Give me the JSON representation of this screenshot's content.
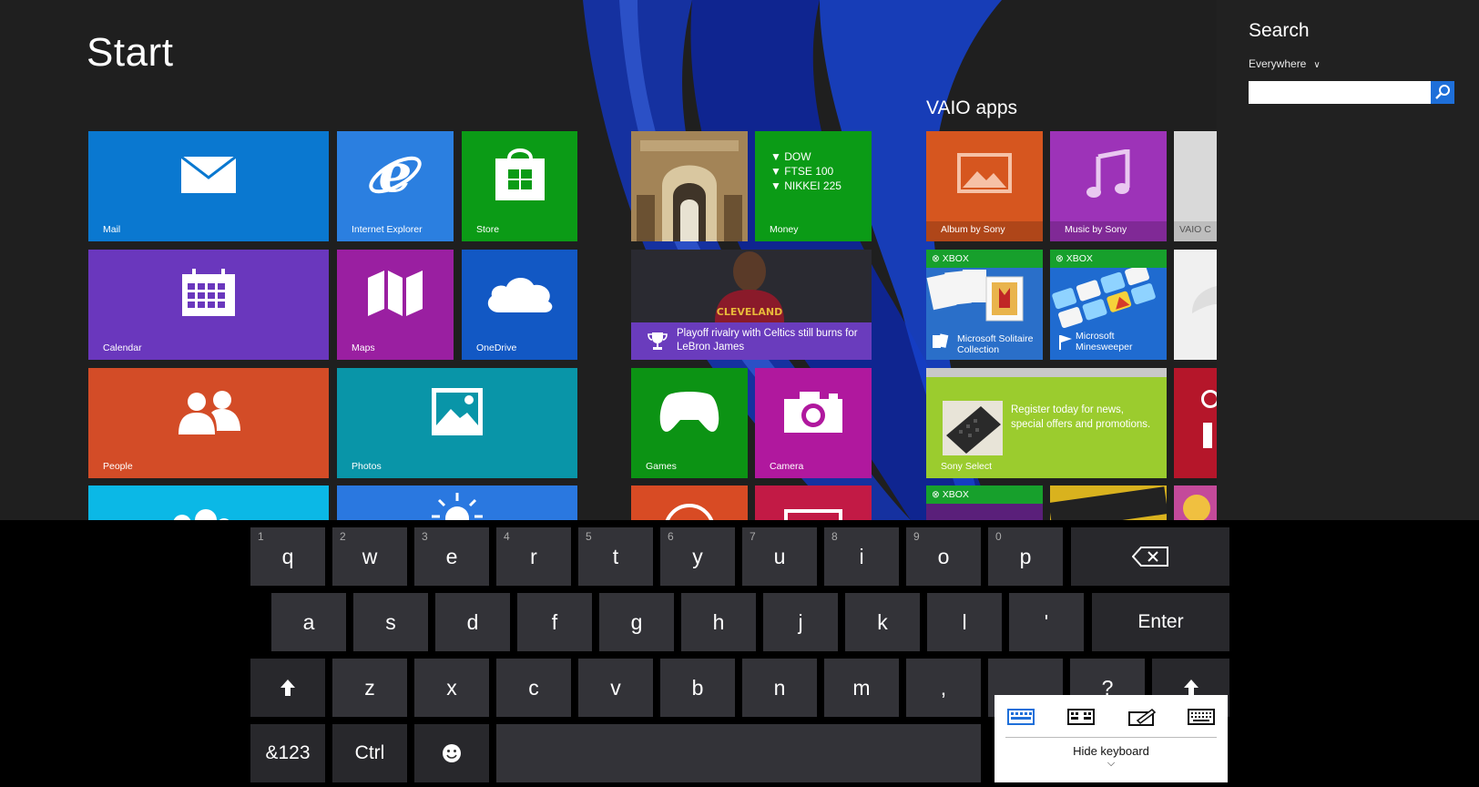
{
  "start": {
    "title": "Start",
    "group_vaio": "VAIO apps"
  },
  "tiles": {
    "mail": "Mail",
    "ie": "Internet Explorer",
    "store": "Store",
    "money": "Money",
    "money_lines": [
      "▼ DOW",
      "▼ FTSE 100",
      "▼ NIKKEI 225"
    ],
    "album": "Album by Sony",
    "music": "Music by Sony",
    "vaio_partial": "VAIO C",
    "calendar": "Calendar",
    "maps": "Maps",
    "onedrive": "OneDrive",
    "news_headline": "Playoff rivalry with Celtics still burns for LeBron James",
    "xbox_badge": "XBOX",
    "solitaire": "Microsoft Solitaire Collection",
    "minesweeper": "Microsoft Minesweeper",
    "people": "People",
    "photos": "Photos",
    "games": "Games",
    "camera": "Camera",
    "sony_select": "Sony Select",
    "sony_select_text": "Register today for news, special offers and promotions."
  },
  "charms": {
    "title": "Search",
    "scope": "Everywhere",
    "input_value": ""
  },
  "keyboard": {
    "row1": [
      {
        "k": "q",
        "n": "1"
      },
      {
        "k": "w",
        "n": "2"
      },
      {
        "k": "e",
        "n": "3"
      },
      {
        "k": "r",
        "n": "4"
      },
      {
        "k": "t",
        "n": "5"
      },
      {
        "k": "y",
        "n": "6"
      },
      {
        "k": "u",
        "n": "7"
      },
      {
        "k": "i",
        "n": "8"
      },
      {
        "k": "o",
        "n": "9"
      },
      {
        "k": "p",
        "n": "0"
      }
    ],
    "row2": [
      "a",
      "s",
      "d",
      "f",
      "g",
      "h",
      "j",
      "k",
      "l",
      "'"
    ],
    "enter": "Enter",
    "row3": [
      "z",
      "x",
      "c",
      "v",
      "b",
      "n",
      "m",
      ","
    ],
    "question": "?",
    "sym": "&123",
    "ctrl": "Ctrl"
  },
  "keyboard_menu": {
    "hide": "Hide keyboard"
  },
  "colors": {
    "mail": "#0a78d0",
    "ie": "#2b7fe0",
    "store": "#0b9b16",
    "money": "#0b9b16",
    "album": "#d6561f",
    "music": "#9d33b8",
    "calendar": "#6a37bd",
    "maps": "#9a1fa1",
    "onedrive": "#1258c4",
    "people": "#d34c27",
    "photos": "#0995a8",
    "games": "#0c9314",
    "camera": "#b0189e",
    "sony_select": "#9bcc2e",
    "xbox_green": "#17a02c",
    "search_accent": "#1e6fd9"
  }
}
